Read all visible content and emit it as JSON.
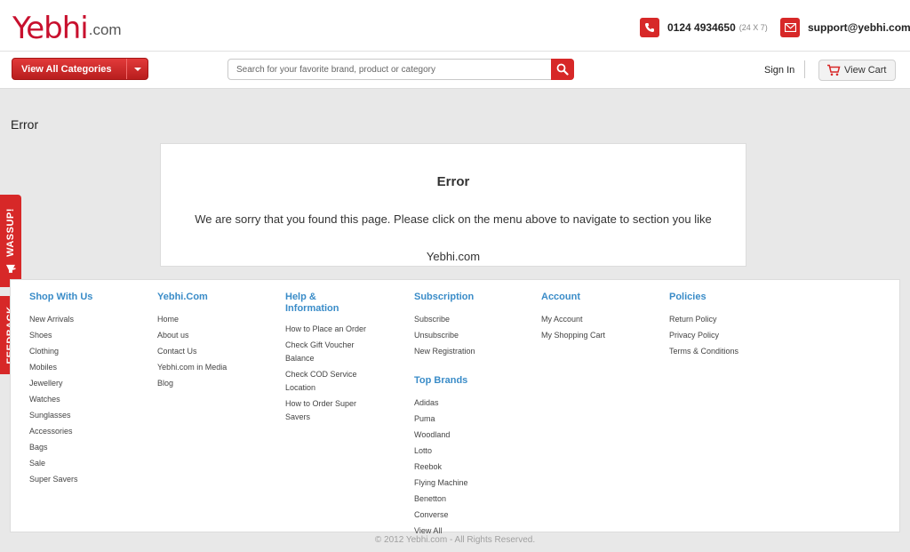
{
  "header": {
    "logo_brand": "Yebhi",
    "logo_tld": ".com",
    "phone": "0124 4934650",
    "phone_hours": "(24 X 7)",
    "email": "support@yebhi.com"
  },
  "nav": {
    "categories_label": "View All Categories",
    "search_placeholder": "Search for your favorite brand, product or category",
    "signin_label": "Sign In",
    "cart_label": "View Cart"
  },
  "main": {
    "page_heading": "Error",
    "error_title": "Error",
    "error_message": "We are sorry that you found this page. Please click on the menu above to navigate to section you like",
    "error_signature": "Yebhi.com"
  },
  "sidetabs": {
    "wassup": "WASSUP!",
    "feedback": "FEEDBACK"
  },
  "footer": {
    "shop": {
      "title": "Shop With Us",
      "items": [
        "New Arrivals",
        "Shoes",
        "Clothing",
        "Mobiles",
        "Jewellery",
        "Watches",
        "Sunglasses",
        "Accessories",
        "Bags",
        "Sale",
        "Super Savers"
      ]
    },
    "yebhi": {
      "title": "Yebhi.Com",
      "items": [
        "Home",
        "About us",
        "Contact Us",
        "Yebhi.com in Media",
        "Blog"
      ]
    },
    "help": {
      "title_line1": "Help &",
      "title_line2": "Information",
      "items": [
        {
          "l1": "How to Place an Order",
          "l2": ""
        },
        {
          "l1": "Check Gift Voucher",
          "l2": "Balance"
        },
        {
          "l1": "Check COD Service",
          "l2": "Location"
        },
        {
          "l1": "How to Order Super",
          "l2": "Savers"
        }
      ]
    },
    "subscription": {
      "title": "Subscription",
      "items": [
        "Subscribe",
        "Unsubscribe",
        "New Registration"
      ]
    },
    "brands": {
      "title": "Top Brands",
      "items": [
        "Adidas",
        "Puma",
        "Woodland",
        "Lotto",
        "Reebok",
        "Flying Machine",
        "Benetton",
        "Converse",
        "View All"
      ]
    },
    "account": {
      "title": "Account",
      "items": [
        "My Account",
        "My Shopping Cart"
      ]
    },
    "policies": {
      "title": "Policies",
      "items": [
        "Return Policy",
        "Privacy Policy",
        "Terms & Conditions"
      ]
    },
    "copyright": "© 2012 Yebhi.com - All Rights Reserved."
  },
  "colors": {
    "brand_red": "#d72828",
    "link_blue": "#3a8cc8"
  },
  "icons": {
    "phone": "phone-icon",
    "email": "envelope-icon",
    "search": "magnifier-icon",
    "cart": "shopping-cart-icon",
    "dropdown": "chevron-down-icon",
    "megaphone": "megaphone-icon"
  }
}
